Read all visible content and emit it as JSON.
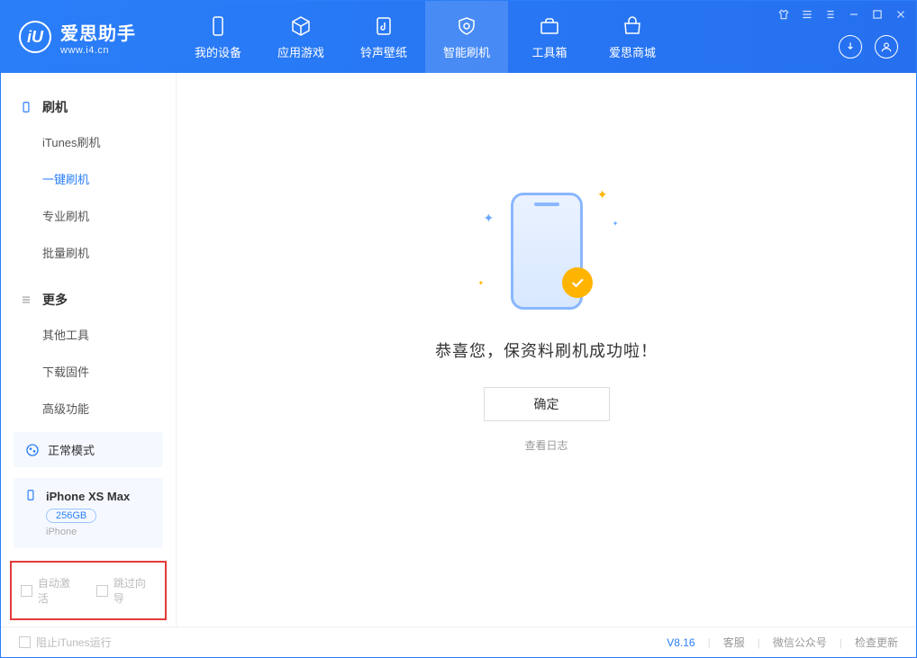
{
  "app": {
    "name_cn": "爱思助手",
    "name_en": "www.i4.cn"
  },
  "tabs": [
    {
      "label": "我的设备"
    },
    {
      "label": "应用游戏"
    },
    {
      "label": "铃声壁纸"
    },
    {
      "label": "智能刷机"
    },
    {
      "label": "工具箱"
    },
    {
      "label": "爱思商城"
    }
  ],
  "tabs_active_index": 3,
  "sidebar": {
    "section1_title": "刷机",
    "section1_items": [
      "iTunes刷机",
      "一键刷机",
      "专业刷机",
      "批量刷机"
    ],
    "section1_active_index": 1,
    "section2_title": "更多",
    "section2_items": [
      "其他工具",
      "下载固件",
      "高级功能"
    ]
  },
  "status": {
    "mode_label": "正常模式"
  },
  "device": {
    "name": "iPhone XS Max",
    "storage": "256GB",
    "type": "iPhone"
  },
  "options": {
    "auto_activate": "自动激活",
    "skip_guide": "跳过向导"
  },
  "main": {
    "message": "恭喜您，保资料刷机成功啦！",
    "ok_button": "确定",
    "view_log": "查看日志"
  },
  "footer": {
    "block_itunes": "阻止iTunes运行",
    "version": "V8.16",
    "support": "客服",
    "wechat": "微信公众号",
    "check_update": "检查更新"
  }
}
